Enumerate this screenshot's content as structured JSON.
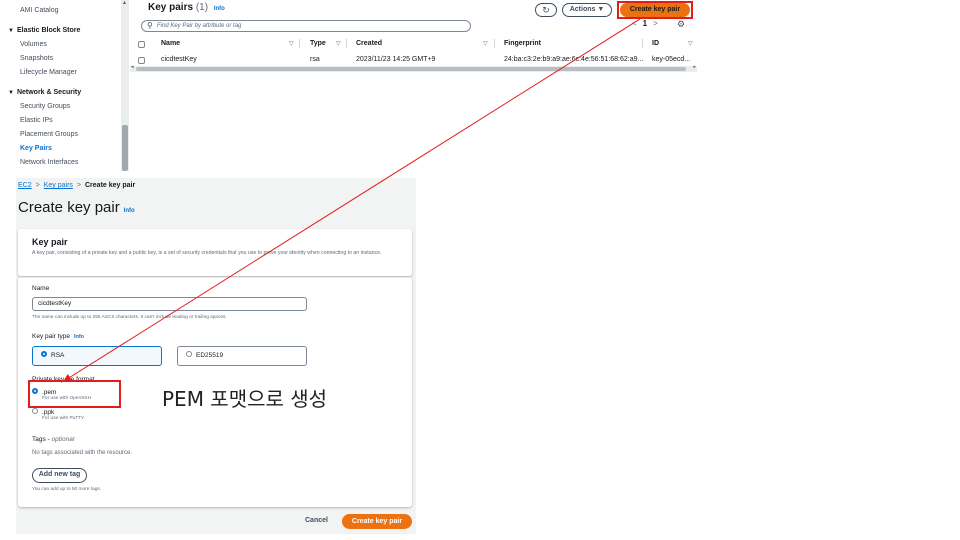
{
  "sidebar": {
    "items": [
      "AMI Catalog",
      "Volumes",
      "Snapshots",
      "Lifecycle Manager",
      "Security Groups",
      "Elastic IPs",
      "Placement Groups",
      "Key Pairs",
      "Network Interfaces"
    ],
    "sections": [
      "Elastic Block Store",
      "Network & Security"
    ],
    "active": "Key Pairs"
  },
  "list": {
    "title": "Key pairs",
    "count": "(1)",
    "info": "Info",
    "refresh_icon": "refresh-icon",
    "actions_label": "Actions ▼",
    "create_label": "Create key pair",
    "search_placeholder": "Find Key Pair by attribute or tag",
    "page": "1",
    "columns": [
      "Name",
      "Type",
      "Created",
      "Fingerprint",
      "ID"
    ],
    "rows": [
      {
        "name": "cicdtestKey",
        "type": "rsa",
        "created": "2023/11/23 14:25 GMT+9",
        "fingerprint": "24:ba:c3:2e:b9:a9:ae:6c:4e:56:51:68:62:a9...",
        "id": "key-05ecd..."
      }
    ]
  },
  "form": {
    "breadcrumb": [
      "EC2",
      "Key pairs",
      "Create key pair"
    ],
    "title": "Create key pair",
    "title_info": "Info",
    "section_title": "Key pair",
    "section_desc": "A key pair, consisting of a private key and a public key, is a set of security credentials that you use to prove your identity when connecting to an instance.",
    "name_label": "Name",
    "name_value": "cicdtestKey",
    "name_hint": "The name can include up to 255 ASCII characters. It can't include leading or trailing spaces.",
    "type_label": "Key pair type",
    "type_info": "Info",
    "type_options": [
      "RSA",
      "ED25519"
    ],
    "type_selected": "RSA",
    "format_label": "Private key file format",
    "formats": [
      {
        "name": ".pem",
        "desc": "For use with OpenSSH",
        "selected": true
      },
      {
        "name": ".ppk",
        "desc": "For use with PuTTY",
        "selected": false
      }
    ],
    "tags_label": "Tags - ",
    "tags_optional": "optional",
    "tags_empty": "No tags associated with the resource.",
    "add_tag_label": "Add new tag",
    "tags_limit": "You can add up to 50 more tags.",
    "cancel_label": "Cancel",
    "create_label": "Create key pair"
  },
  "annotation": {
    "text": "PEM 포맷으로 생성",
    "color": "#e01e1e"
  },
  "colors": {
    "accent_orange": "#ec7211",
    "link_blue": "#0972d3",
    "highlight_red": "#e01e1e"
  }
}
